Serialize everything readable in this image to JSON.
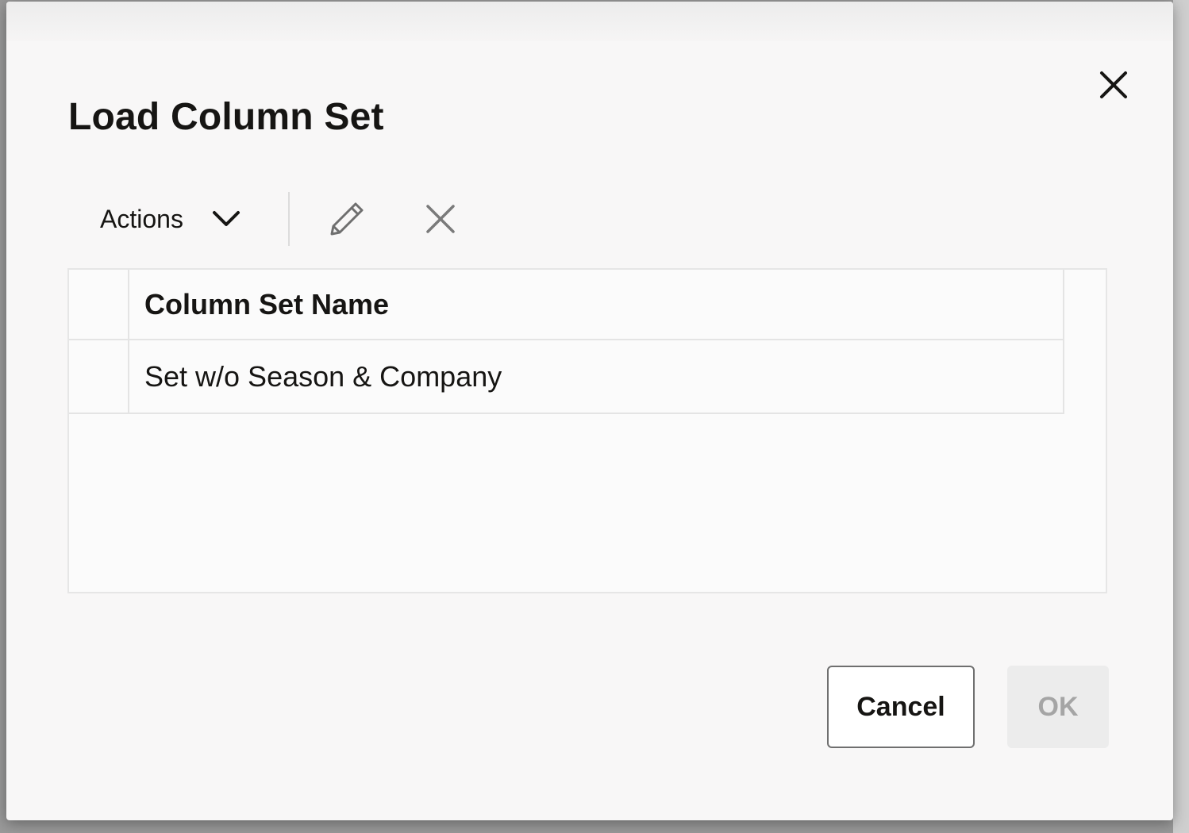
{
  "dialog": {
    "title": "Load Column Set",
    "close_icon": "close-icon"
  },
  "toolbar": {
    "actions_label": "Actions",
    "actions_icon": "chevron-down-icon",
    "edit_icon": "pencil-icon",
    "delete_icon": "x-icon"
  },
  "table": {
    "columns": [
      "Column Set Name"
    ],
    "rows": [
      {
        "name": "Set w/o Season & Company"
      }
    ]
  },
  "footer": {
    "cancel_label": "Cancel",
    "ok_label": "OK"
  },
  "colors": {
    "text": "#161513",
    "disabled_text": "#a5a5a5",
    "disabled_bg": "#ececec",
    "icon_muted": "#6f6f6f"
  }
}
